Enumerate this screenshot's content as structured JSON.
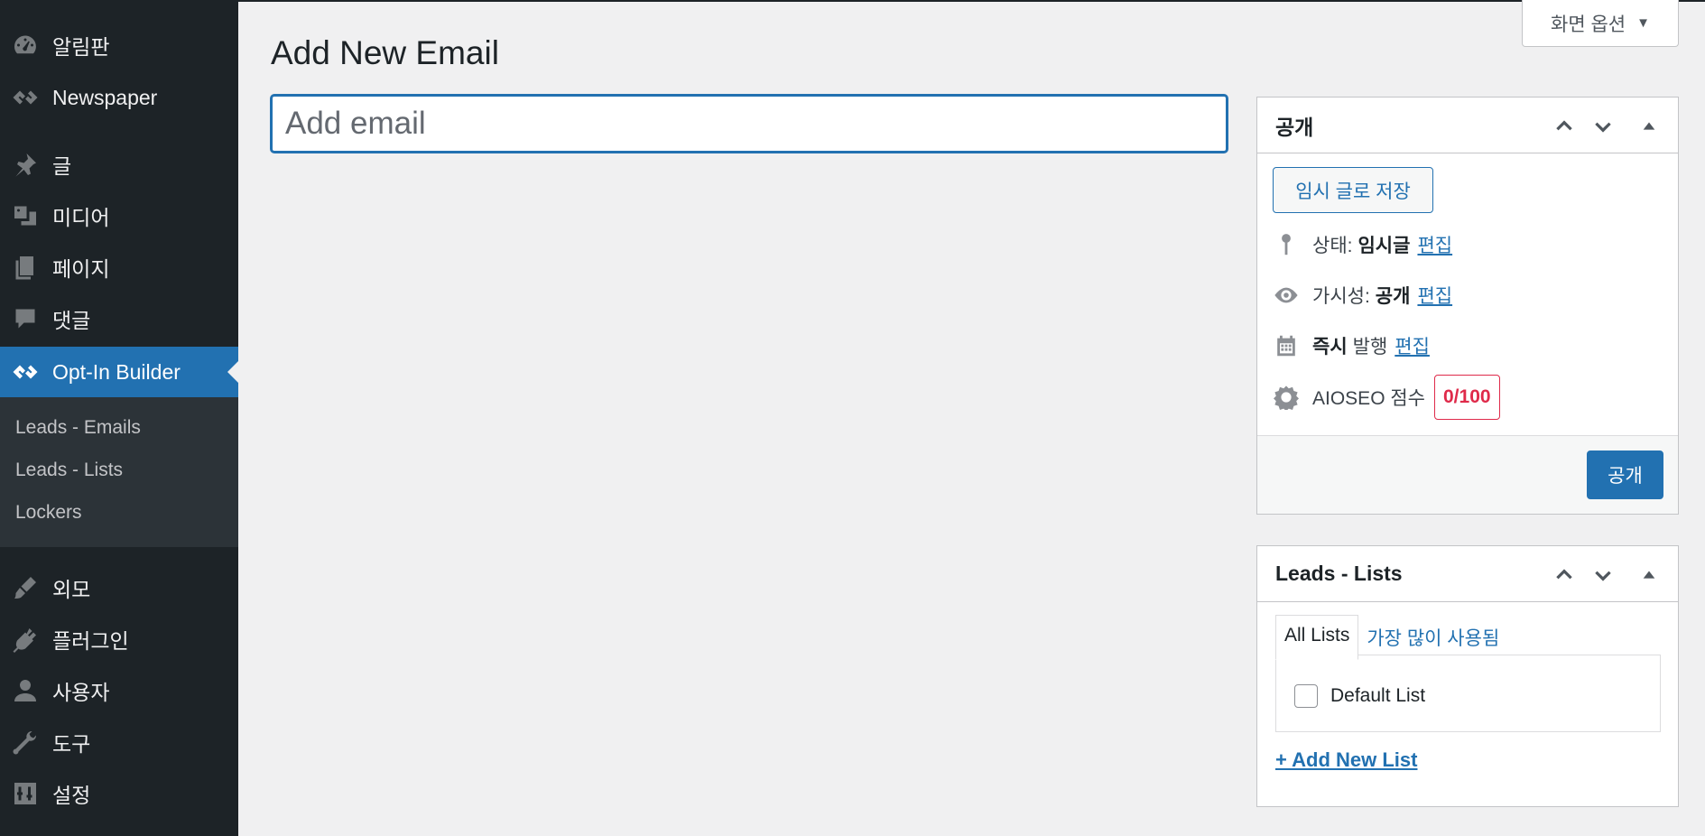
{
  "sidebar": {
    "items": [
      {
        "label": "알림판",
        "icon": "dashboard-icon"
      },
      {
        "label": "Newspaper",
        "icon": "newspaper-logo-icon"
      },
      {
        "label": "글",
        "icon": "pushpin-icon"
      },
      {
        "label": "미디어",
        "icon": "media-icon"
      },
      {
        "label": "페이지",
        "icon": "pages-icon"
      },
      {
        "label": "댓글",
        "icon": "comment-icon"
      },
      {
        "label": "Opt-In Builder",
        "icon": "optin-logo-icon"
      },
      {
        "label": "외모",
        "icon": "paintbrush-icon"
      },
      {
        "label": "플러그인",
        "icon": "plugin-icon"
      },
      {
        "label": "사용자",
        "icon": "user-icon"
      },
      {
        "label": "도구",
        "icon": "wrench-icon"
      },
      {
        "label": "설정",
        "icon": "settings-sliders-icon"
      }
    ],
    "submenu": [
      "Leads - Emails",
      "Leads - Lists",
      "Lockers"
    ]
  },
  "header": {
    "screen_options": "화면 옵션",
    "title": "Add New Email"
  },
  "title_input": {
    "placeholder": "Add email",
    "value": ""
  },
  "publish_box": {
    "title": "공개",
    "save_draft": "임시 글로 저장",
    "status_label": "상태:",
    "status_value": "임시글",
    "visibility_label": "가시성:",
    "visibility_value": "공개",
    "schedule_bold": "즉시",
    "schedule_label": "발행",
    "edit_link": "편집",
    "aioseo_label": "AIOSEO 점수",
    "aioseo_score": "0/100",
    "publish_button": "공개"
  },
  "lists_box": {
    "title": "Leads - Lists",
    "tabs": [
      "All Lists",
      "가장 많이 사용됨"
    ],
    "lists": [
      {
        "label": "Default List",
        "checked": false
      }
    ],
    "add_new": "+ Add New List"
  },
  "colors": {
    "sidebar_bg": "#1d2327",
    "accent": "#2271b1",
    "score_red": "#df2a4a"
  }
}
